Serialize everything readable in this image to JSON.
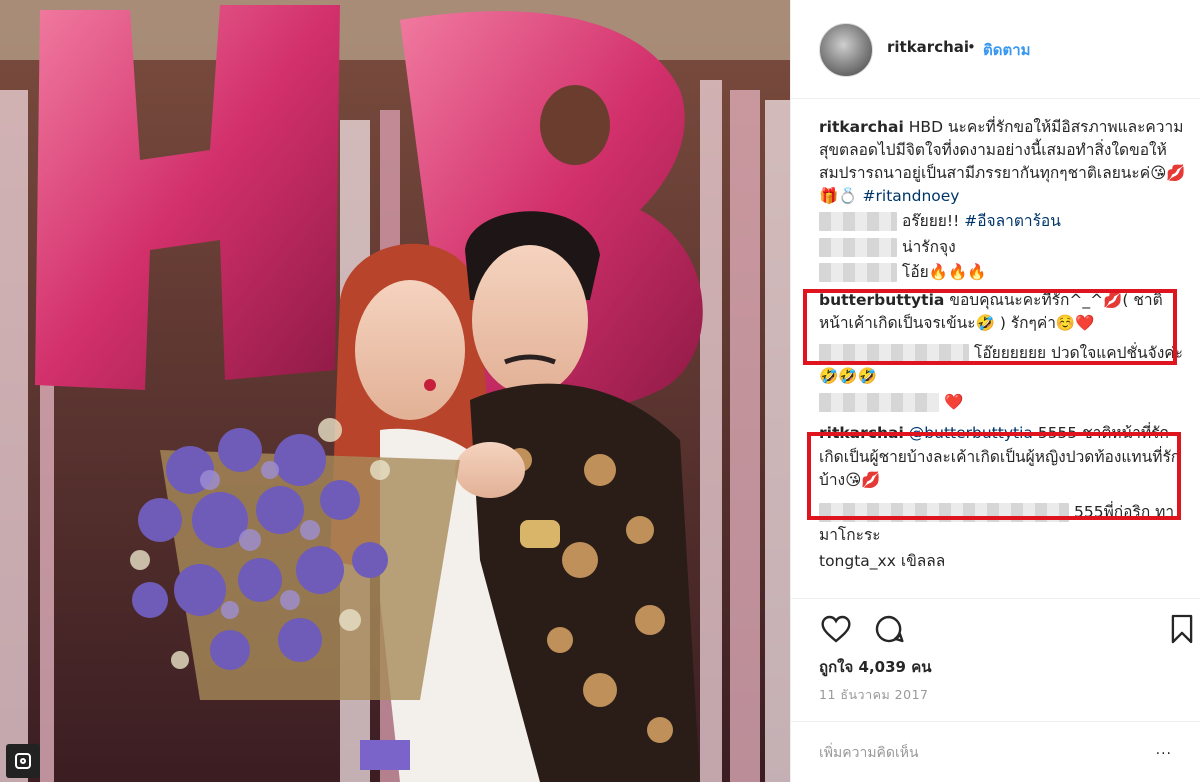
{
  "post": {
    "username": "ritkarchai",
    "separator": "•",
    "follow_label": "ติดตาม"
  },
  "photo": {
    "description_icon": "instagram-camera-icon"
  },
  "comments": [
    {
      "user": "ritkarchai",
      "text": "HBD นะคะที่รักขอให้มีอิสรภาพและความสุขตลอดไปมีจิตใจที่งดงามอย่างนี้เสมอทำสิ่งใดขอให้สมปรารถนาอยู่เป็นสามีภรรยากันทุกๆชาติเลยนะค่",
      "emoji": "😘💋🎁💍",
      "hashtag": "#ritandnoey"
    },
    {
      "user": "",
      "text": "อร๊ยยย!!",
      "hashtag": "#อีจลาตาร้อน"
    },
    {
      "user": "",
      "text": "น่ารักจุง"
    },
    {
      "user": "",
      "text": "โอ้ย",
      "emoji": "🔥🔥🔥"
    },
    {
      "user": "butterbuttytia",
      "text": "ขอบคุณนะคะที่รัก^_^💋( ชาติหน้าเค้าเกิดเป็นจรเข้นะ🤣 ) รักๆค่า☺️❤️"
    },
    {
      "user": "",
      "text": "โอ๊ยยยยยย ปวดใจแคปชั่นจังค่ะ",
      "emoji": "🤣🤣🤣"
    },
    {
      "user": "",
      "text": "",
      "emoji": "❤️"
    },
    {
      "user": "ritkarchai",
      "mention": "@butterbuttytia",
      "text": "5555 ชาติหน้าที่รักเกิดเป็นผู้ชายบ้างละเค้าเกิดเป็นผู้หญิงปวดท้องแทนที่รักบ้าง",
      "emoji": "😘💋"
    },
    {
      "user": "",
      "text": "555พี่ก่อริก ทามาโกะระ"
    },
    {
      "user": "tongta_xx",
      "text": "เขิลลล"
    }
  ],
  "actions": {
    "like_icon": "heart-icon",
    "comment_icon": "comment-icon",
    "save_icon": "bookmark-icon",
    "likes_label": "ถูกใจ",
    "likes_count": "4,039",
    "likes_unit": "คน",
    "date": "11 ธันวาคม 2017",
    "add_comment_placeholder": "เพิ่มความคิดเห็น",
    "more_label": "..."
  },
  "colors": {
    "link": "#003569",
    "follow": "#3897f0",
    "highlight_box": "#e0141e"
  }
}
